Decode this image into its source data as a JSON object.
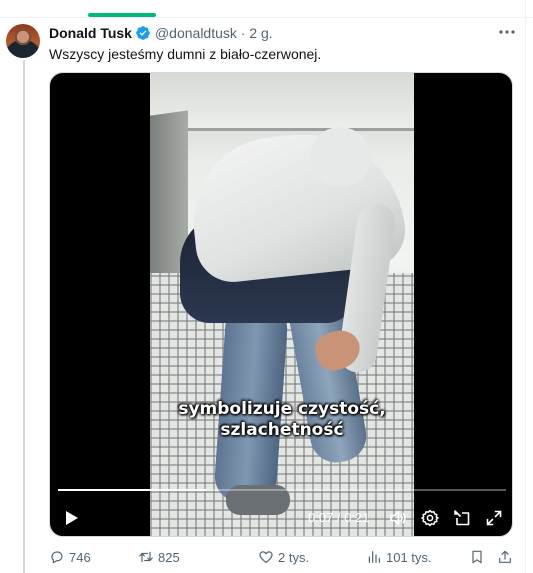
{
  "tweet": {
    "display_name": "Donald Tusk",
    "handle_time": "@donaldtusk · 2 g.",
    "text": "Wszyscy jesteśmy dumni z biało-czerwonej.",
    "more_icon": "more-horizontal-icon"
  },
  "video": {
    "caption_line1": "symbolizuje czystość,",
    "caption_line2": "szlachetność",
    "time": "0:07 / 0:21",
    "progress": 0.33,
    "icons": [
      "play-icon",
      "volume-icon",
      "settings-icon",
      "picture-in-picture-icon",
      "fullscreen-icon"
    ]
  },
  "actions": {
    "replies": "746",
    "reposts": "825",
    "likes": "2 tys.",
    "views": "101 tys."
  },
  "colors": {
    "accent_green": "#00ba7c",
    "verified_blue": "#1d9bf0",
    "secondary_text": "#536471"
  }
}
